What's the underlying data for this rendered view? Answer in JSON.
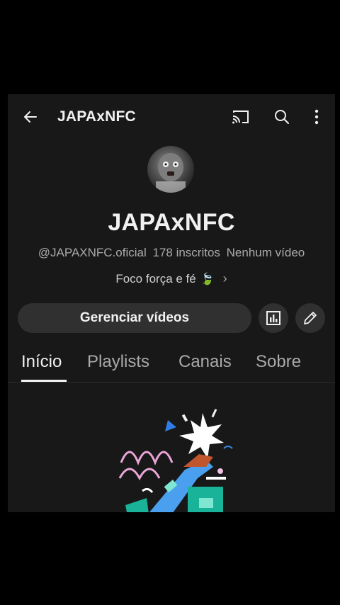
{
  "header": {
    "title": "JAPAxNFC",
    "icons": [
      "back-arrow-icon",
      "cast-icon",
      "search-icon",
      "more-vert-icon"
    ]
  },
  "channel": {
    "name": "JAPAxNFC",
    "handle": "@JAPAXNFC.oficial",
    "subscribers": "178 inscritos",
    "videos": "Nenhum vídeo",
    "description": "Foco força e fé",
    "description_emoji": "🍃"
  },
  "actions": {
    "manage_label": "Gerenciar vídeos",
    "stats_icon": "analytics-icon",
    "edit_icon": "pencil-icon"
  },
  "tabs": [
    {
      "label": "Início",
      "active": true
    },
    {
      "label": "Playlists",
      "active": false
    },
    {
      "label": "Canais",
      "active": false
    },
    {
      "label": "Sobre",
      "active": false
    }
  ],
  "colors": {
    "background": "#181818",
    "button_bg": "#303030",
    "text_primary": "#f1f1f1",
    "text_secondary": "#aaaaaa"
  }
}
